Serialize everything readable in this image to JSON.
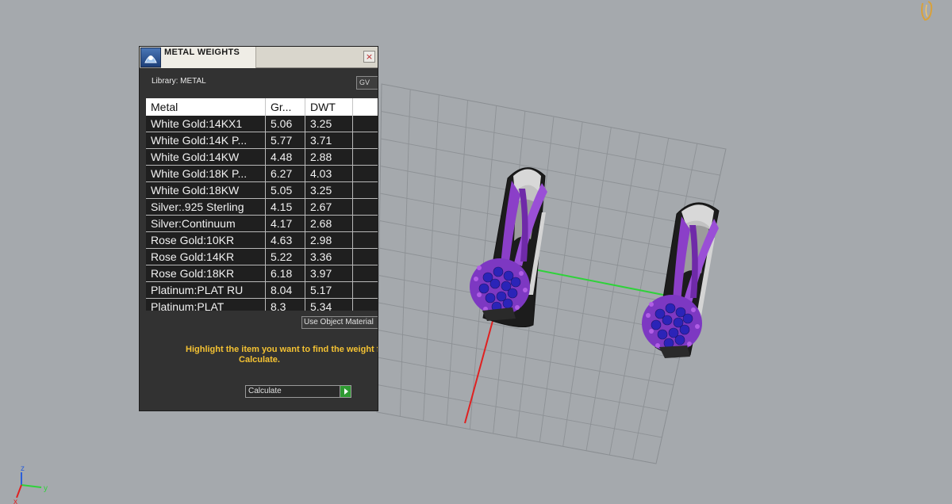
{
  "panel": {
    "title": "METAL WEIGHTS",
    "close_glyph": "×",
    "library_label": "Library: METAL",
    "library_code": "GV",
    "use_object_button": "Use Object Material",
    "instruction_line1": "Highlight the item you want to find the weight for",
    "instruction_line2": "Calculate.",
    "calculate_label": "Calculate"
  },
  "table": {
    "headers": [
      "Metal",
      "Gr...",
      "DWT",
      ""
    ],
    "rows": [
      [
        "White Gold:14KX1",
        "5.06",
        "3.25"
      ],
      [
        "White Gold:14K P...",
        "5.77",
        "3.71"
      ],
      [
        "White Gold:14KW",
        "4.48",
        "2.88"
      ],
      [
        "White Gold:18K P...",
        "6.27",
        "4.03"
      ],
      [
        "White Gold:18KW",
        "5.05",
        "3.25"
      ],
      [
        "Silver:.925 Sterling",
        "4.15",
        "2.67"
      ],
      [
        "Silver:Continuum",
        "4.17",
        "2.68"
      ],
      [
        "Rose Gold:10KR",
        "4.63",
        "2.98"
      ],
      [
        "Rose Gold:14KR",
        "5.22",
        "3.36"
      ],
      [
        "Rose Gold:18KR",
        "6.18",
        "3.97"
      ],
      [
        "Platinum:PLAT RU",
        "8.04",
        "5.17"
      ],
      [
        "Platinum:PLAT",
        "8.3",
        "5.34"
      ]
    ]
  },
  "axes": {
    "z_label": "z",
    "y_label": "y",
    "x_label": "x"
  },
  "colors": {
    "viewport_bg": "#a5a9ad",
    "panel_bg": "#323232",
    "instruction_text": "#f4c233",
    "calculate_go": "#2f9a32",
    "prong_purple": "#8b3fc8",
    "gem_blue": "#2b24b8"
  },
  "icons": {
    "app_icon": "rhino-app-icon",
    "corner_icon": "ring-logo-icon",
    "calculate_go": "play-triangle-icon"
  }
}
